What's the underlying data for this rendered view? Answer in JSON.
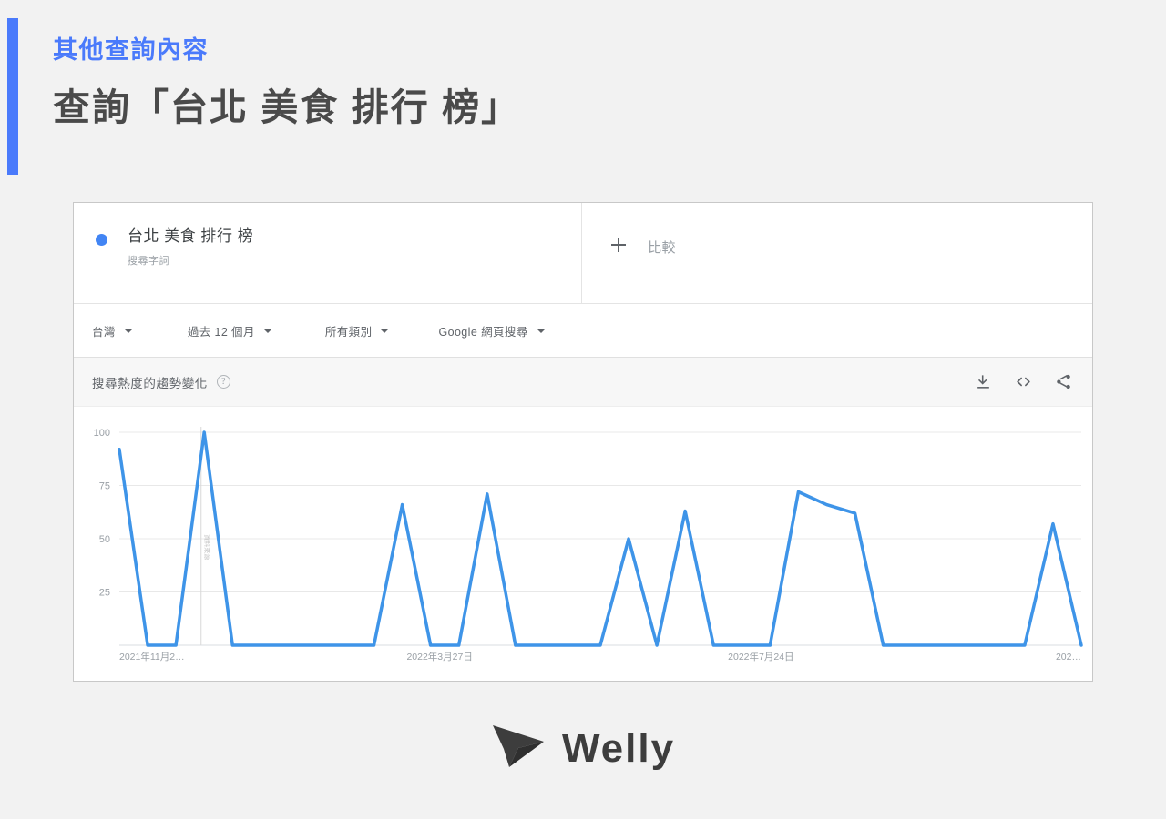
{
  "slide": {
    "eyebrow": "其他查詢內容",
    "headline": "查詢「台北 美食 排行 榜」",
    "accent_color": "#4a7afb",
    "headline_color": "#4a4a4a",
    "background_color": "#f2f2f2"
  },
  "trends": {
    "term": {
      "title": "台北 美食 排行 榜",
      "subtitle": "搜尋字詞",
      "dot_color": "#4285f4"
    },
    "compare": {
      "label": "比較",
      "icon": "plus-icon"
    },
    "filters": [
      {
        "label": "台灣",
        "icon": "chevron-down-icon"
      },
      {
        "label": "過去 12 個月",
        "icon": "chevron-down-icon"
      },
      {
        "label": "所有類別",
        "icon": "chevron-down-icon"
      },
      {
        "label": "Google 網頁搜尋",
        "icon": "chevron-down-icon"
      }
    ],
    "chart_panel": {
      "title": "搜尋熱度的趨勢變化",
      "help_icon": "help-circle-icon",
      "help_glyph": "?",
      "actions": [
        {
          "name": "download-icon"
        },
        {
          "name": "embed-code-icon"
        },
        {
          "name": "share-icon"
        }
      ]
    }
  },
  "chart_data": {
    "type": "line",
    "title": "搜尋熱度的趨勢變化",
    "xlabel": "",
    "ylabel": "",
    "ylim": [
      0,
      100
    ],
    "yticks": [
      25,
      50,
      75,
      100
    ],
    "ytick_labels": [
      "25",
      "50",
      "75",
      "100"
    ],
    "xtick_labels": [
      "2021年11月2…",
      "2022年3月27日",
      "2022年7月24日",
      "202…"
    ],
    "xtick_positions": [
      0,
      0.333,
      0.667,
      1.0
    ],
    "grid": true,
    "legend": false,
    "line_color": "#3e94e8",
    "line_width": 3.5,
    "annotation_marker": {
      "x_fraction": 0.085,
      "label": "資料來源"
    },
    "series": [
      {
        "name": "台北 美食 排行 榜",
        "values": [
          92,
          0,
          0,
          100,
          0,
          0,
          0,
          0,
          0,
          0,
          66,
          0,
          0,
          71,
          0,
          0,
          0,
          0,
          50,
          0,
          63,
          0,
          0,
          0,
          72,
          66,
          62,
          0,
          0,
          0,
          0,
          0,
          0,
          57,
          0
        ]
      }
    ]
  },
  "logo": {
    "text": "Welly",
    "mark": "paper-plane-icon",
    "color": "#3d3d3d"
  }
}
